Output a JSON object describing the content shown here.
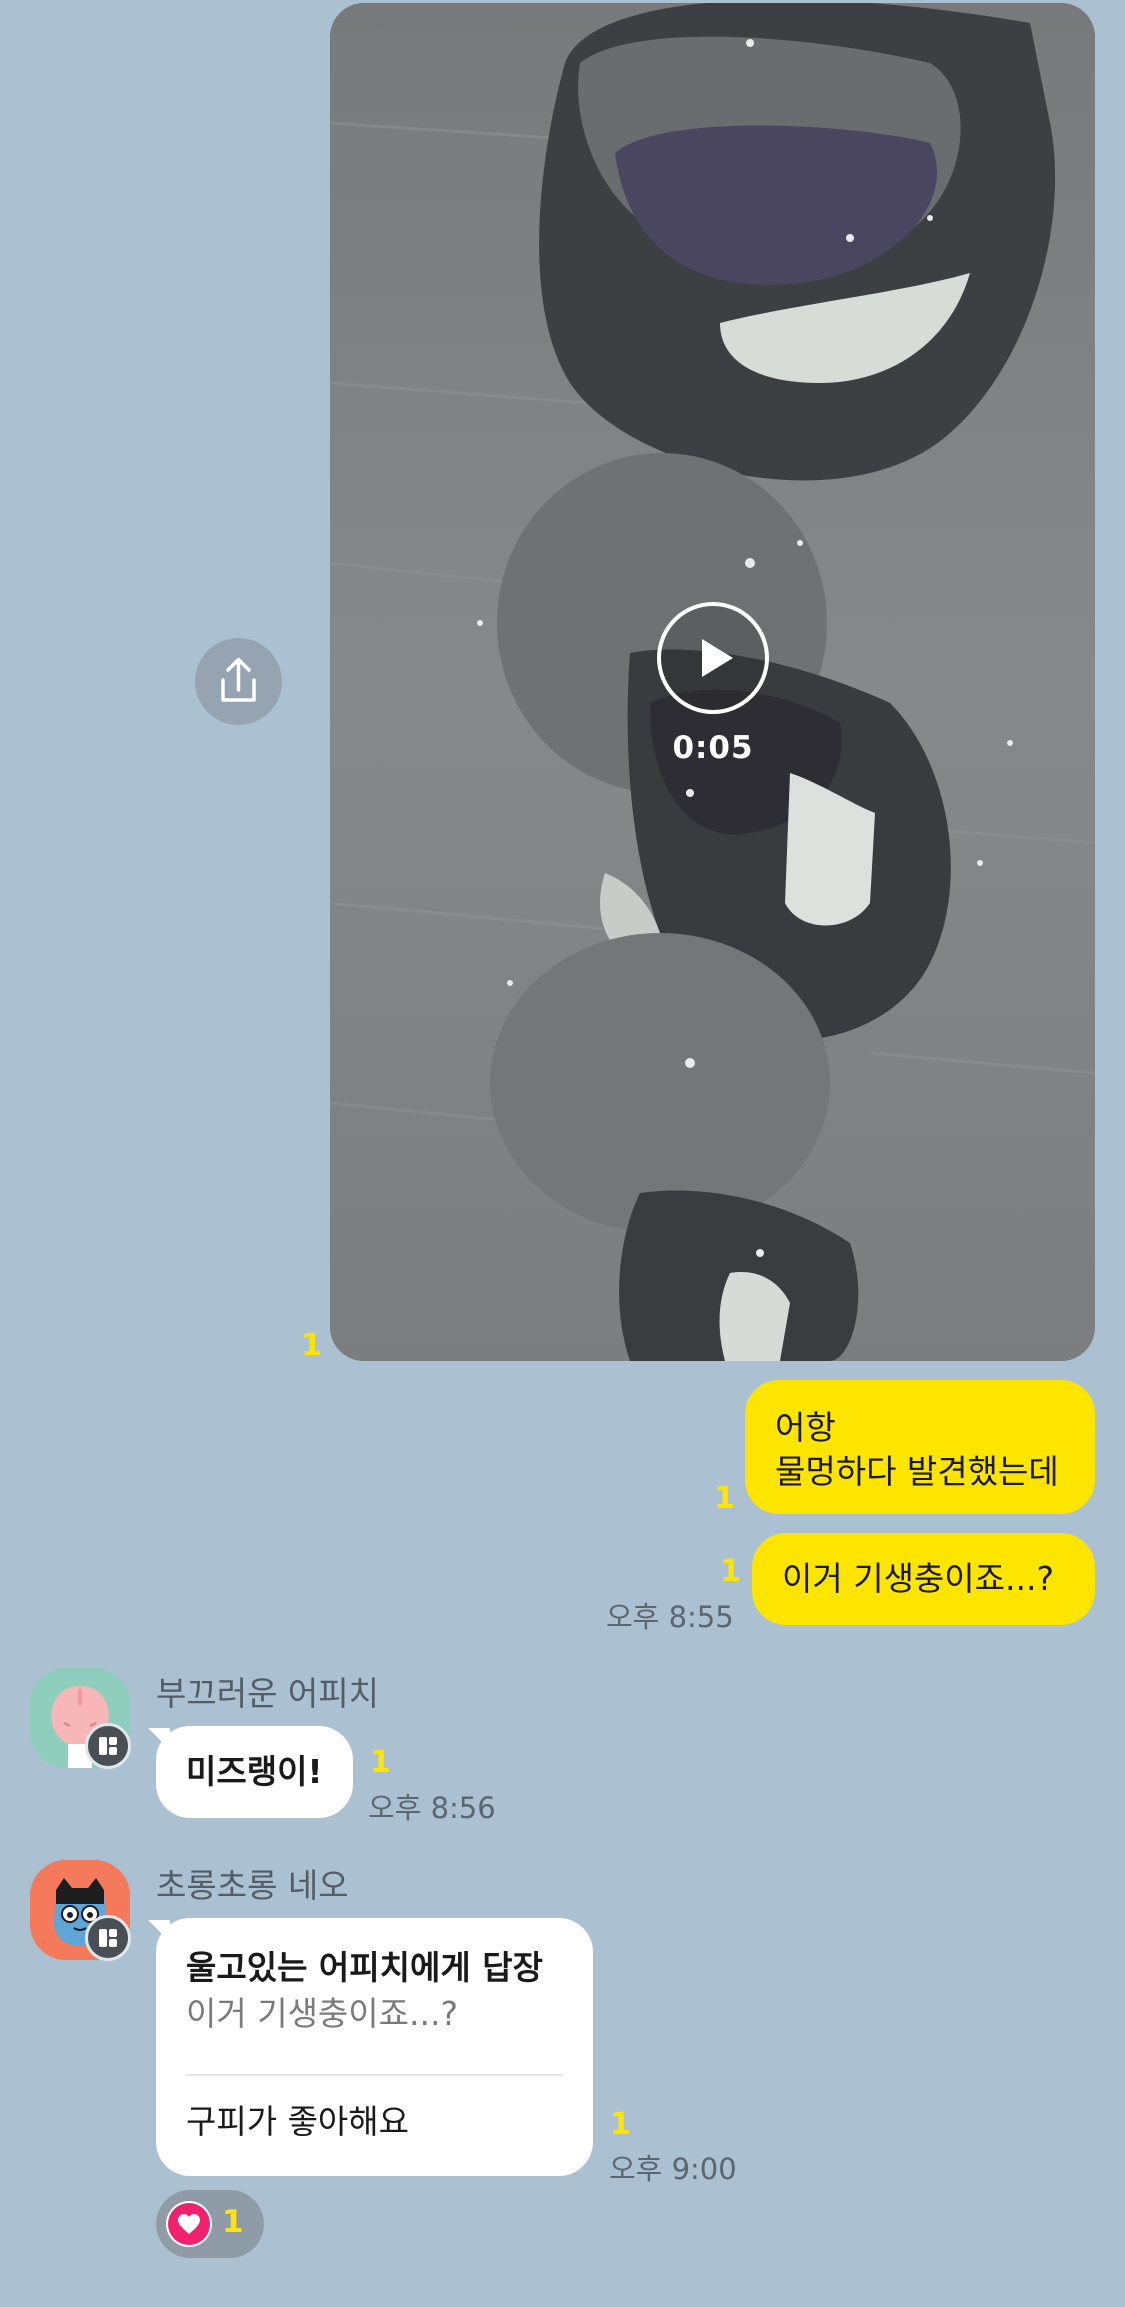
{
  "video_message": {
    "duration": "0:05",
    "unread_count": "1"
  },
  "my_messages": [
    {
      "lines": [
        "어항",
        "물멍하다 발견했는데"
      ],
      "unread_count": "1"
    },
    {
      "lines": [
        "이거 기생충이죠...?"
      ],
      "unread_count": "1",
      "time": "오후 8:55"
    }
  ],
  "friend_messages": [
    {
      "sender": "부끄러운 어피치",
      "text": "미즈랭이!",
      "unread_count": "1",
      "time": "오후 8:56",
      "avatar_icon": "apeach-avatar"
    },
    {
      "sender": "초롱초롱 네오",
      "reply_header": "울고있는 어피치에게 답장",
      "reply_quote": "이거 기생충이죠...?",
      "text": "구피가 좋아해요",
      "unread_count": "1",
      "time": "오후 9:00",
      "avatar_icon": "neo-avatar",
      "reaction": {
        "icon": "heart-icon",
        "count": "1"
      }
    }
  ],
  "colors": {
    "background": "#abc1d1",
    "my_bubble": "#fee500",
    "friend_bubble": "#ffffff",
    "unread": "#ffe500",
    "heart": "#f2216d"
  }
}
